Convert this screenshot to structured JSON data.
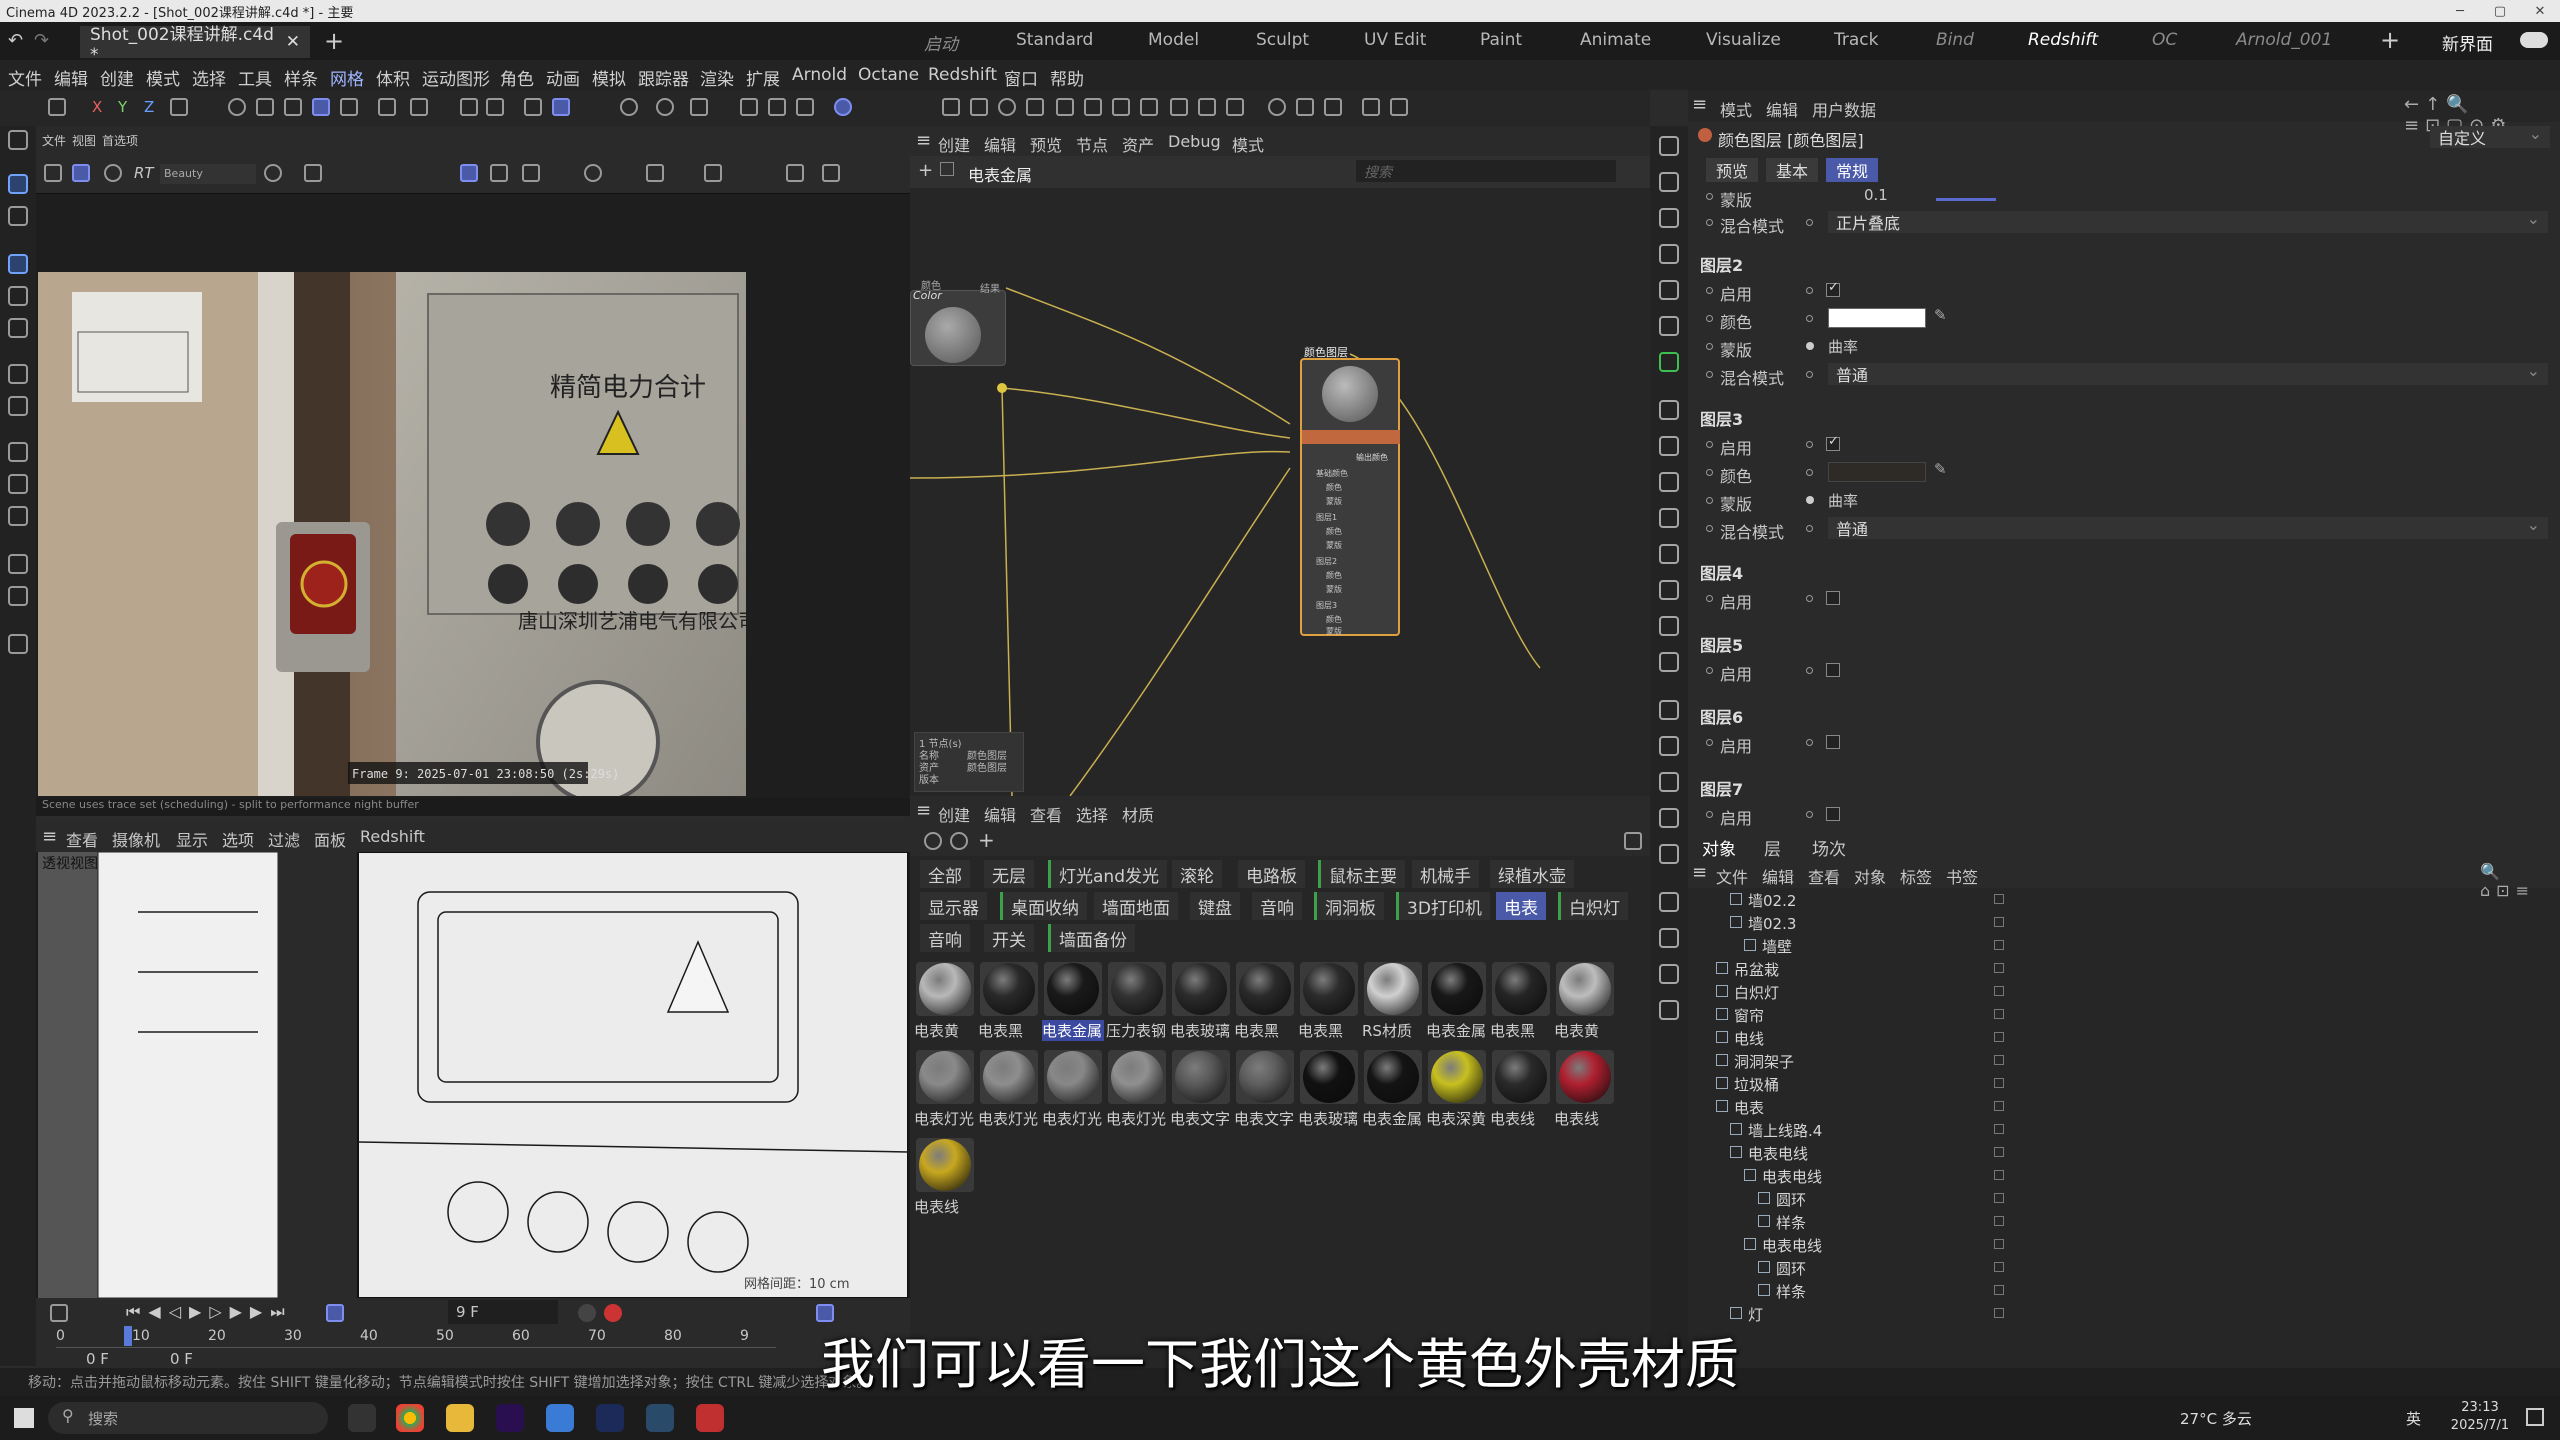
{
  "window": {
    "title": "Cinema 4D 2023.2.2 - [Shot_002课程讲解.c4d *] - 主要"
  },
  "tabs": {
    "doc": "Shot_002课程讲解.c4d *",
    "layouts": [
      "启动",
      "Standard",
      "Model",
      "Sculpt",
      "UV Edit",
      "Paint",
      "Animate",
      "Visualize",
      "Track",
      "Bind",
      "Redshift",
      "OC",
      "Arnold_001"
    ],
    "active_layout": "Redshift",
    "new_interface": "新界面"
  },
  "menu": [
    "文件",
    "编辑",
    "创建",
    "模式",
    "选择",
    "工具",
    "样条",
    "网格",
    "体积",
    "运动图形",
    "角色",
    "动画",
    "模拟",
    "跟踪器",
    "渲染",
    "扩展",
    "Arnold",
    "Octane",
    "Redshift",
    "窗口",
    "帮助"
  ],
  "toolbar": {
    "axes": [
      "X",
      "Y",
      "Z"
    ]
  },
  "render_view": {
    "menu": [
      "文件",
      "视图",
      "首选项"
    ],
    "rt_label": "RT",
    "beauty": "Beauty",
    "frame_info": "Frame  9:  2025-07-01  23:08:50  (2s:29s)",
    "sign_text": "精简电力合计",
    "sign_text2": "唐山深圳艺浦电气有限公司",
    "status": "Scene uses trace set (scheduling) - split to performance night buffer"
  },
  "viewport2": {
    "menu": [
      "查看",
      "摄像机",
      "显示",
      "选项",
      "过滤",
      "面板",
      "Redshift"
    ],
    "label": "透视视图",
    "grid_info": "网格间距：10 cm"
  },
  "timeline": {
    "frame": "9 F",
    "ticks": [
      "0",
      "10",
      "20",
      "30",
      "40",
      "50",
      "60",
      "70",
      "80",
      "9"
    ],
    "start": "0 F",
    "end": "0 F"
  },
  "node_editor": {
    "menu": [
      "创建",
      "编辑",
      "预览",
      "节点",
      "资产",
      "Debug",
      "模式"
    ],
    "breadcrumb": "电表金属",
    "search_placeholder": "搜索",
    "color_node_small": "颜色",
    "color_node_title": "Color",
    "out_port": "结果",
    "layer_node_title": "颜色图层",
    "layer_out": "输出颜色",
    "ports": [
      "基础颜色",
      "颜色",
      "蒙版",
      "图层1",
      "颜色",
      "蒙版",
      "图层2",
      "颜色",
      "蒙版",
      "图层3",
      "颜色",
      "蒙版"
    ],
    "info_lines": [
      "1 节点(s)",
      "名称",
      "资产",
      "版本"
    ],
    "info_values": [
      "颜色图层",
      "颜色图层"
    ]
  },
  "material_manager": {
    "menu": [
      "创建",
      "编辑",
      "查看",
      "选择",
      "材质"
    ],
    "tabs_row1": [
      "全部",
      "无层",
      "灯光and发光",
      "滚轮",
      "电路板",
      "鼠标主要",
      "机械手",
      "绿植水壶"
    ],
    "tabs_row2": [
      "显示器",
      "桌面收纳",
      "墙面地面",
      "键盘",
      "音响",
      "洞洞板",
      "3D打印机",
      "电表",
      "白炽灯"
    ],
    "tabs_row3": [
      "音响",
      "开关",
      "墙面备份"
    ],
    "active_tab": "电表",
    "materials": [
      {
        "name": "电表黄",
        "color": "#b8b8b8"
      },
      {
        "name": "电表黑",
        "color": "#2a2a2a"
      },
      {
        "name": "电表金属",
        "color": "#1a1a1a"
      },
      {
        "name": "压力表钢",
        "color": "#333333"
      },
      {
        "name": "电表玻璃",
        "color": "#2c2c2c"
      },
      {
        "name": "电表黑",
        "color": "#2a2a2a"
      },
      {
        "name": "电表黑",
        "color": "#2c2c2c"
      },
      {
        "name": "RS材质",
        "color": "#d0d0d0"
      },
      {
        "name": "电表金属",
        "color": "#181818"
      },
      {
        "name": "电表黑",
        "color": "#252525"
      },
      {
        "name": "电表黄",
        "color": "#bdbdbd"
      },
      {
        "name": "电表灯光",
        "color": "#8a8a8a"
      },
      {
        "name": "电表灯光",
        "color": "#8e8e8e"
      },
      {
        "name": "电表灯光",
        "color": "#888888"
      },
      {
        "name": "电表灯光",
        "color": "#909090"
      },
      {
        "name": "电表文字",
        "color": "#5a5a5a"
      },
      {
        "name": "电表文字",
        "color": "#5e5e5e"
      },
      {
        "name": "电表玻璃",
        "color": "#111111"
      },
      {
        "name": "电表金属",
        "color": "#141414"
      },
      {
        "name": "电表深黄",
        "color": "#c8c020"
      },
      {
        "name": "电表线",
        "color": "#2a2a2a"
      },
      {
        "name": "电表线",
        "color": "#b02030"
      },
      {
        "name": "电表线",
        "color": "#c8a820"
      }
    ],
    "selected_index": 2
  },
  "attribute_manager": {
    "menu": [
      "模式",
      "编辑",
      "用户数据"
    ],
    "title": "颜色图层 [颜色图层]",
    "preset": "自定义",
    "tabs": [
      "预览",
      "基本",
      "常规"
    ],
    "active_tab": "常规",
    "rows": [
      {
        "group": "",
        "label": "蒙版",
        "value": "0.1"
      },
      {
        "group": "",
        "label": "混合模式",
        "value": "正片叠底"
      }
    ],
    "layers": [
      {
        "name": "图层2",
        "enable_label": "启用",
        "enabled": true,
        "color_label": "颜色",
        "color": "#ffffff",
        "mask_label": "蒙版",
        "mask_value": "曲率",
        "blend_label": "混合模式",
        "blend": "普通"
      },
      {
        "name": "图层3",
        "enable_label": "启用",
        "enabled": true,
        "color_label": "颜色",
        "color": "#2e2a26",
        "mask_label": "蒙版",
        "mask_value": "曲率",
        "blend_label": "混合模式",
        "blend": "普通"
      },
      {
        "name": "图层4",
        "enable_label": "启用",
        "enabled": false
      },
      {
        "name": "图层5",
        "enable_label": "启用",
        "enabled": false
      },
      {
        "name": "图层6",
        "enable_label": "启用",
        "enabled": false
      },
      {
        "name": "图层7",
        "enable_label": "启用",
        "enabled": false
      }
    ]
  },
  "object_manager": {
    "tabs": [
      "对象",
      "层",
      "场次"
    ],
    "menu": [
      "文件",
      "编辑",
      "查看",
      "对象",
      "标签",
      "书签"
    ],
    "rows": [
      {
        "name": "墙02.2",
        "indent": 2
      },
      {
        "name": "墙02.3",
        "indent": 2
      },
      {
        "name": "墙壁",
        "indent": 3
      },
      {
        "name": "吊盆栽",
        "indent": 1
      },
      {
        "name": "白炽灯",
        "indent": 1
      },
      {
        "name": "窗帘",
        "indent": 1
      },
      {
        "name": "电线",
        "indent": 1
      },
      {
        "name": "洞洞架子",
        "indent": 1
      },
      {
        "name": "垃圾桶",
        "indent": 1
      },
      {
        "name": "电表",
        "indent": 1
      },
      {
        "name": "墙上线路.4",
        "indent": 2
      },
      {
        "name": "电表电线",
        "indent": 2
      },
      {
        "name": "电表电线",
        "indent": 3
      },
      {
        "name": "圆环",
        "indent": 4
      },
      {
        "name": "样条",
        "indent": 4
      },
      {
        "name": "电表电线",
        "indent": 3
      },
      {
        "name": "圆环",
        "indent": 4
      },
      {
        "name": "样条",
        "indent": 4
      },
      {
        "name": "灯",
        "indent": 2
      }
    ]
  },
  "subtitle": "我们可以看一下我们这个黄色外壳材质",
  "status": "移动：点击并拖动鼠标移动元素。按住 SHIFT 键量化移动；节点编辑模式时按住 SHIFT 键增加选择对象；按住 CTRL 键减少选择对象。",
  "taskbar": {
    "search": "搜索",
    "weather": "27°C 多云",
    "lang": "英",
    "time": "23:13",
    "date": "2025/7/1"
  }
}
